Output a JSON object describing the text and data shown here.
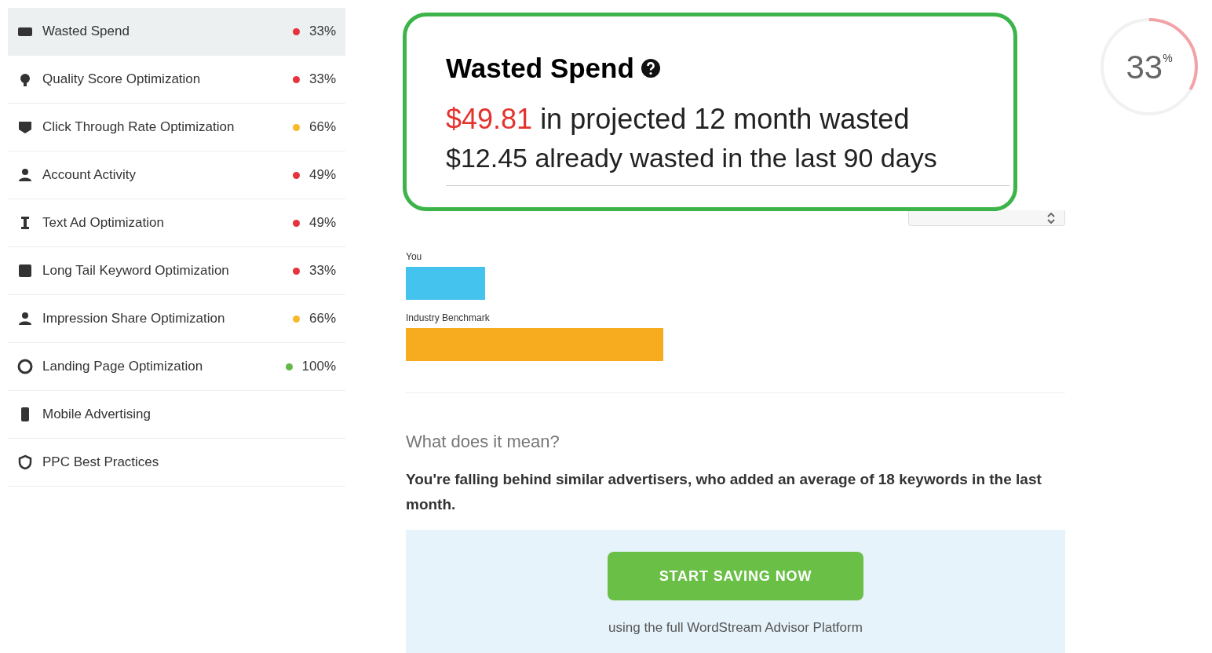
{
  "sidebar": {
    "items": [
      {
        "label": "Wasted Spend",
        "score": "33%",
        "color": "#e5343d",
        "selected": true
      },
      {
        "label": "Quality Score Optimization",
        "score": "33%",
        "color": "#e5343d",
        "selected": false
      },
      {
        "label": "Click Through Rate Optimization",
        "score": "66%",
        "color": "#f9b82a",
        "selected": false
      },
      {
        "label": "Account Activity",
        "score": "49%",
        "color": "#e5343d",
        "selected": false
      },
      {
        "label": "Text Ad Optimization",
        "score": "49%",
        "color": "#e5343d",
        "selected": false
      },
      {
        "label": "Long Tail Keyword Optimization",
        "score": "33%",
        "color": "#e5343d",
        "selected": false
      },
      {
        "label": "Impression Share Optimization",
        "score": "66%",
        "color": "#f9b82a",
        "selected": false
      },
      {
        "label": "Landing Page Optimization",
        "score": "100%",
        "color": "#62b946",
        "selected": false
      },
      {
        "label": "Mobile Advertising",
        "selected": false
      },
      {
        "label": "PPC Best Practices",
        "selected": false
      }
    ]
  },
  "gauge": {
    "value": "33",
    "unit": "%",
    "level": 0.33
  },
  "callout": {
    "title": "Wasted Spend",
    "projected": "$49.81",
    "projected_text": "in projected 12 month wasted",
    "already": "$12.45 already wasted in the last 90 days"
  },
  "comparison": {
    "bars": [
      {
        "label": "You",
        "level": 0.12,
        "color": "#45c3ef"
      },
      {
        "label": "Industry Benchmark",
        "level": 0.39,
        "color": "#f7ac1f"
      }
    ]
  },
  "explanation": {
    "heading": "What does it mean?",
    "text": "You're falling behind similar advertisers, who added an average of 18 keywords in the last month."
  },
  "cta": {
    "button": "START SAVING NOW",
    "note": "using the full WordStream Advisor Platform"
  }
}
